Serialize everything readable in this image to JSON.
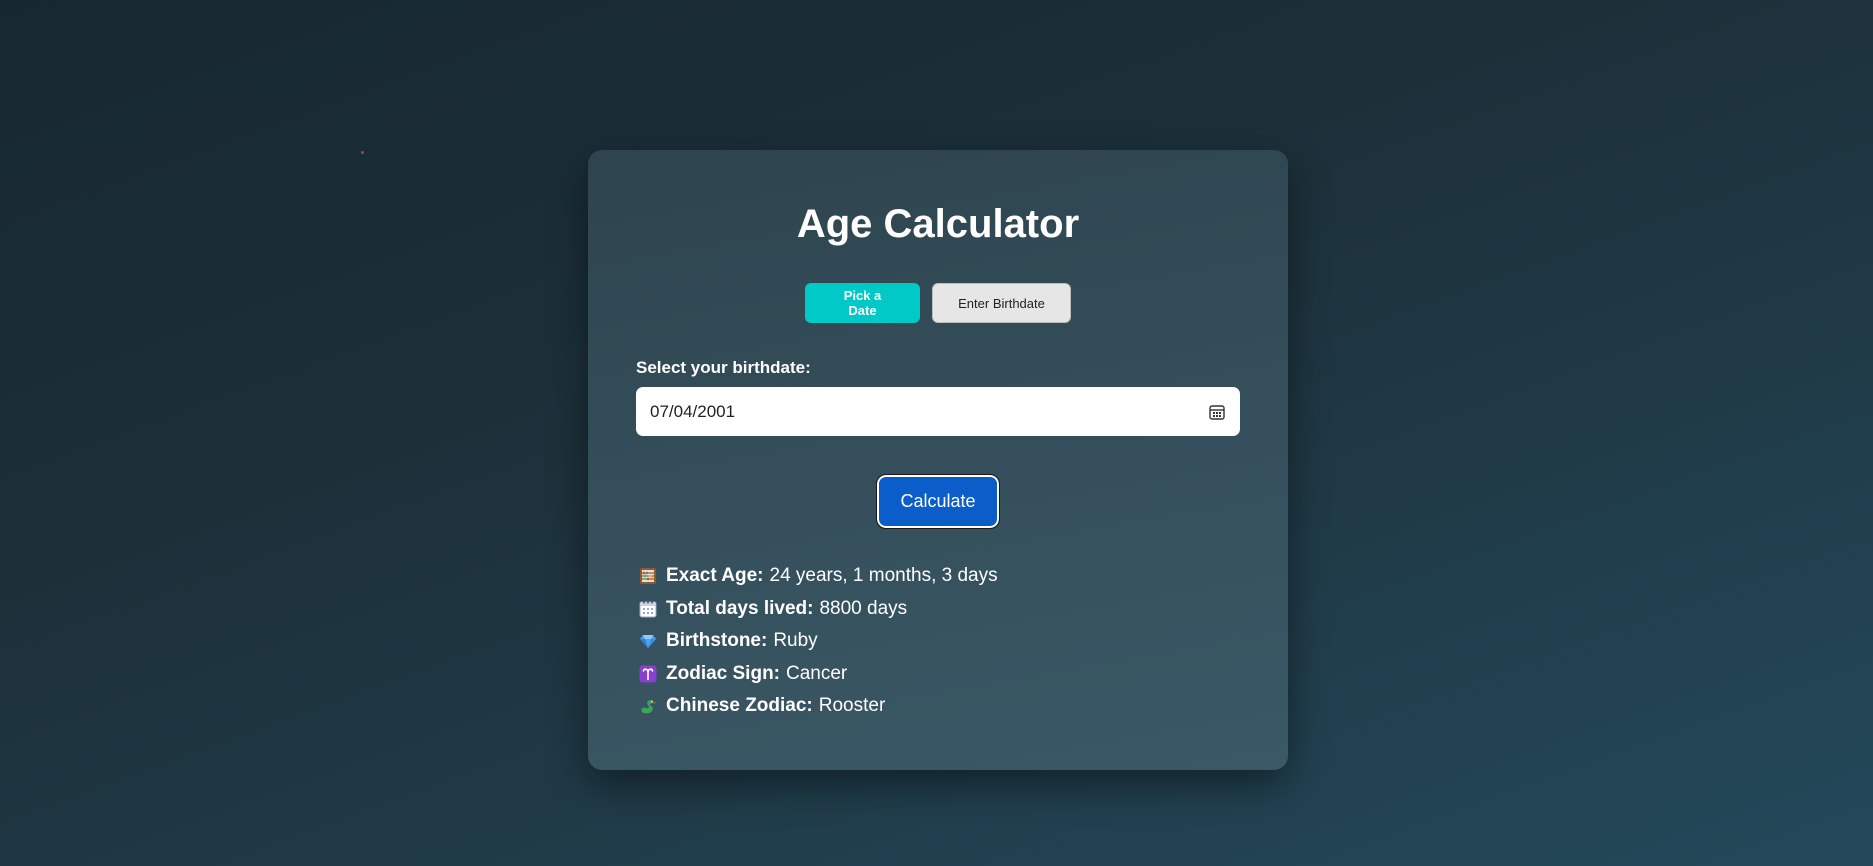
{
  "app": {
    "title": "Age Calculator"
  },
  "mode_tabs": [
    {
      "label": "Pick a Date",
      "active": true
    },
    {
      "label": "Enter Birthdate",
      "active": false
    }
  ],
  "birthdate": {
    "label": "Select your birthdate:",
    "value": "07/04/2001",
    "icon": "calendar-icon"
  },
  "calculate": {
    "label": "Calculate"
  },
  "results": [
    {
      "icon": "abacus-icon",
      "label": "Exact Age:",
      "value": "24 years, 1 months, 3 days"
    },
    {
      "icon": "calendar-spiral-icon",
      "label": "Total days lived:",
      "value": "8800 days"
    },
    {
      "icon": "gem-icon",
      "label": "Birthstone:",
      "value": "Ruby"
    },
    {
      "icon": "zodiac-aries-icon",
      "label": "Zodiac Sign:",
      "value": "Cancer"
    },
    {
      "icon": "dragon-icon",
      "label": "Chinese Zodiac:",
      "value": "Rooster"
    }
  ],
  "colors": {
    "accent_teal": "#00c9c8",
    "button_blue": "#0b5ec9",
    "inactive_gray": "#e6e6e6"
  }
}
